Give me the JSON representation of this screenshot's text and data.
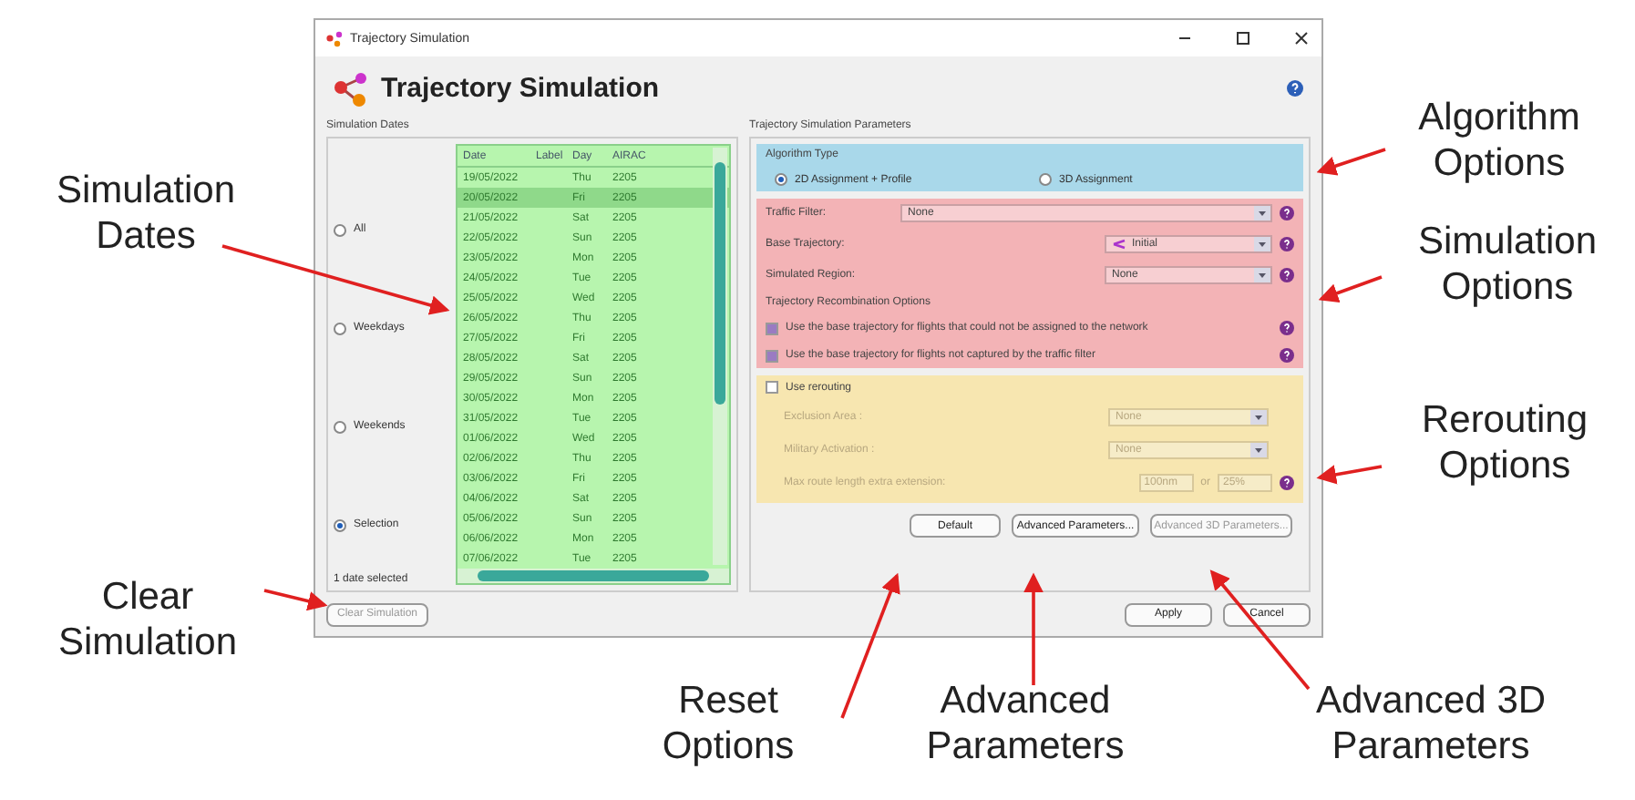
{
  "window": {
    "title": "Trajectory Simulation",
    "header": "Trajectory Simulation"
  },
  "simulation_dates": {
    "legend": "Simulation Dates",
    "options": [
      {
        "label": "All",
        "selected": false
      },
      {
        "label": "Weekdays",
        "selected": false
      },
      {
        "label": "Weekends",
        "selected": false
      },
      {
        "label": "Selection",
        "selected": true
      }
    ],
    "table": {
      "columns": [
        "Date",
        "Label",
        "Day",
        "AIRAC"
      ],
      "rows": [
        {
          "date": "19/05/2022",
          "day": "Thu",
          "airac": "2205",
          "selected": false
        },
        {
          "date": "20/05/2022",
          "day": "Fri",
          "airac": "2205",
          "selected": true
        },
        {
          "date": "21/05/2022",
          "day": "Sat",
          "airac": "2205",
          "selected": false
        },
        {
          "date": "22/05/2022",
          "day": "Sun",
          "airac": "2205",
          "selected": false
        },
        {
          "date": "23/05/2022",
          "day": "Mon",
          "airac": "2205",
          "selected": false
        },
        {
          "date": "24/05/2022",
          "day": "Tue",
          "airac": "2205",
          "selected": false
        },
        {
          "date": "25/05/2022",
          "day": "Wed",
          "airac": "2205",
          "selected": false
        },
        {
          "date": "26/05/2022",
          "day": "Thu",
          "airac": "2205",
          "selected": false
        },
        {
          "date": "27/05/2022",
          "day": "Fri",
          "airac": "2205",
          "selected": false
        },
        {
          "date": "28/05/2022",
          "day": "Sat",
          "airac": "2205",
          "selected": false
        },
        {
          "date": "29/05/2022",
          "day": "Sun",
          "airac": "2205",
          "selected": false
        },
        {
          "date": "30/05/2022",
          "day": "Mon",
          "airac": "2205",
          "selected": false
        },
        {
          "date": "31/05/2022",
          "day": "Tue",
          "airac": "2205",
          "selected": false
        },
        {
          "date": "01/06/2022",
          "day": "Wed",
          "airac": "2205",
          "selected": false
        },
        {
          "date": "02/06/2022",
          "day": "Thu",
          "airac": "2205",
          "selected": false
        },
        {
          "date": "03/06/2022",
          "day": "Fri",
          "airac": "2205",
          "selected": false
        },
        {
          "date": "04/06/2022",
          "day": "Sat",
          "airac": "2205",
          "selected": false
        },
        {
          "date": "05/06/2022",
          "day": "Sun",
          "airac": "2205",
          "selected": false
        },
        {
          "date": "06/06/2022",
          "day": "Mon",
          "airac": "2205",
          "selected": false
        },
        {
          "date": "07/06/2022",
          "day": "Tue",
          "airac": "2205",
          "selected": false
        }
      ]
    },
    "status": "1 date selected",
    "clear_button": {
      "label": "Clear Simulation",
      "disabled": true
    }
  },
  "parameters": {
    "legend": "Trajectory Simulation Parameters",
    "algorithm": {
      "title": "Algorithm Type",
      "options": [
        {
          "label": "2D Assignment + Profile",
          "selected": true
        },
        {
          "label": "3D Assignment",
          "selected": false
        }
      ]
    },
    "simulation": {
      "fields": [
        {
          "kind": "wide",
          "label": "Traffic Filter:",
          "value": "None"
        },
        {
          "kind": "icon",
          "label": "Base Trajectory:",
          "value": "Initial"
        },
        {
          "kind": "plain",
          "label": "Simulated Region:",
          "value": "None"
        }
      ],
      "recombination_title": "Trajectory Recombination Options",
      "checks": [
        {
          "label": "Use the base trajectory for flights that could not be assigned to the network",
          "checked": true
        },
        {
          "label": "Use the base trajectory for flights not captured by the traffic filter",
          "checked": true
        }
      ]
    },
    "rerouting": {
      "label": "Use rerouting",
      "checked": false,
      "fields": [
        {
          "label": "Exclusion Area :",
          "value": "None"
        },
        {
          "label": "Military Activation :",
          "value": "None"
        }
      ],
      "extension": {
        "label": "Max route length extra extension:",
        "value1": "100nm",
        "joiner": "or",
        "value2": "25%"
      }
    },
    "buttons": [
      {
        "label": "Default",
        "disabled": false
      },
      {
        "label": "Advanced Parameters...",
        "disabled": false
      },
      {
        "label": "Advanced 3D Parameters...",
        "disabled": true
      }
    ]
  },
  "footer_buttons": [
    "Apply",
    "Cancel"
  ],
  "callouts": [
    {
      "text": "Simulation Dates"
    },
    {
      "text": "Algorithm Options"
    },
    {
      "text": "Simulation Options"
    },
    {
      "text": "Rerouting Options"
    },
    {
      "text": "Clear Simulation"
    },
    {
      "text": "Reset Options"
    },
    {
      "text": "Advanced Parameters"
    },
    {
      "text": "Advanced 3D Parameters"
    }
  ]
}
